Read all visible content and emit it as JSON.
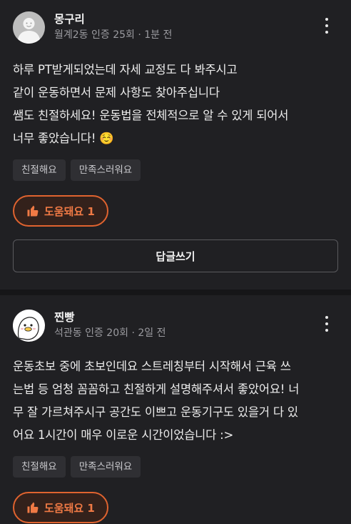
{
  "reviews": [
    {
      "user_name": "몽구리",
      "user_meta": "월계2동 인증 25회 · 1분 전",
      "avatar_icon": "default-person-avatar",
      "body": "하루 PT받게되었는데 자세 교정도 다 봐주시고\n같이 운동하면서 문제 사항도 찾아주십니다\n쌤도 친절하세요! 운동법을 전체적으로 알 수 있게 되어서\n너무 좋았습니다! ☺️",
      "tags": [
        "친절해요",
        "만족스러워요"
      ],
      "helpful_label": "도움돼요 1",
      "reply_label": "답글쓰기"
    },
    {
      "user_name": "찐빵",
      "user_meta": "석관동 인증 20회 · 2일 전",
      "avatar_icon": "duck-avatar",
      "body": "운동초보 중에 초보인데요 스트레칭부터 시작해서 근육 쓰\n는법 등 엄청 꼼꼼하고 친절하게 설명해주셔서 좋았어요! 너\n무 잘 가르쳐주시구 공간도 이쁘고 운동기구도 있을거 다 있\n어요 1시간이 매우 이로운 시간이었습니다 :>",
      "tags": [
        "친절해요",
        "만족스러워요"
      ],
      "helpful_label": "도움돼요 1"
    }
  ],
  "colors": {
    "background": "#202023",
    "accent": "#e0632f",
    "tag_bg": "#2f2f33"
  }
}
